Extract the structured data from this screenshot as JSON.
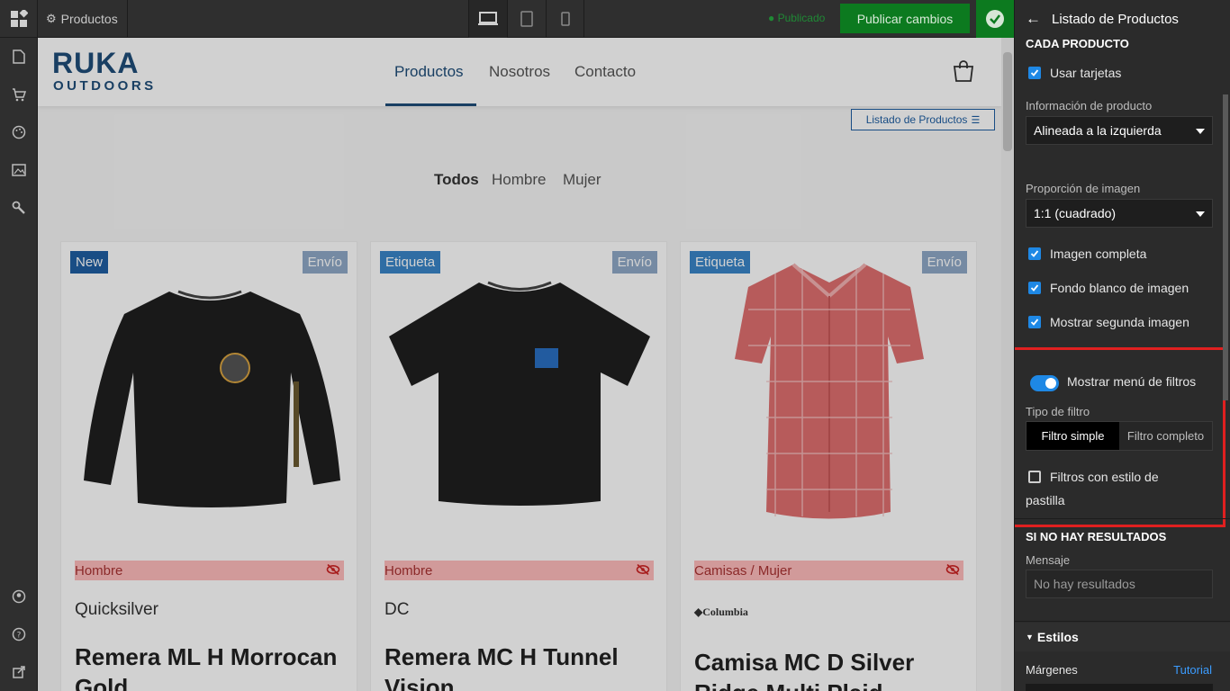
{
  "topbar": {
    "page_name": "Productos",
    "published_label": "● Publicado",
    "publish_button": "Publicar cambios",
    "devices": [
      "desktop-icon",
      "tablet-icon",
      "mobile-icon"
    ]
  },
  "site": {
    "brand_line1": "RUKA",
    "brand_line2": "OUTDOORS",
    "nav": [
      "Productos",
      "Nosotros",
      "Contacto"
    ],
    "section_chip": "Listado de Productos",
    "filters": [
      "Todos",
      "Hombre",
      "Mujer"
    ],
    "products": [
      {
        "badge": "New",
        "shipping": "Envío",
        "category": "Hombre",
        "brand": "Quicksilver",
        "name": "Remera ML H Morrocan Gold"
      },
      {
        "badge": "Etiqueta",
        "shipping": "Envío",
        "category": "Hombre",
        "brand": "DC",
        "name": "Remera MC H Tunnel Vision"
      },
      {
        "badge": "Etiqueta",
        "shipping": "Envío",
        "category": "Camisas / Mujer",
        "brand": "◆Columbia",
        "name": "Camisa MC D Silver Ridge Multi Plaid"
      }
    ]
  },
  "panel": {
    "title": "Listado de Productos",
    "section_card": "CADA PRODUCTO",
    "use_cards": "Usar tarjetas",
    "info_label": "Información de producto",
    "info_value": "Alineada a la izquierda",
    "ratio_label": "Proporción de imagen",
    "ratio_value": "1:1 (cuadrado)",
    "full_image": "Imagen completa",
    "white_bg": "Fondo blanco de imagen",
    "second_image": "Mostrar segunda imagen",
    "show_filters": "Mostrar menú de filtros",
    "filter_type_label": "Tipo de filtro",
    "filter_simple": "Filtro simple",
    "filter_full": "Filtro completo",
    "pill_filters_line1": "Filtros con estilo de",
    "pill_filters_line2": "pastilla",
    "no_results_title": "SI NO HAY RESULTADOS",
    "message_label": "Mensaje",
    "message_value": "No hay resultados",
    "styles_title": "Estilos",
    "margins_label": "Márgenes",
    "tutorial_link": "Tutorial"
  },
  "colors": {
    "accent": "#1e88e5",
    "publish": "#0c7a1f",
    "brand": "#1f4e79",
    "highlight": "#e02020"
  }
}
